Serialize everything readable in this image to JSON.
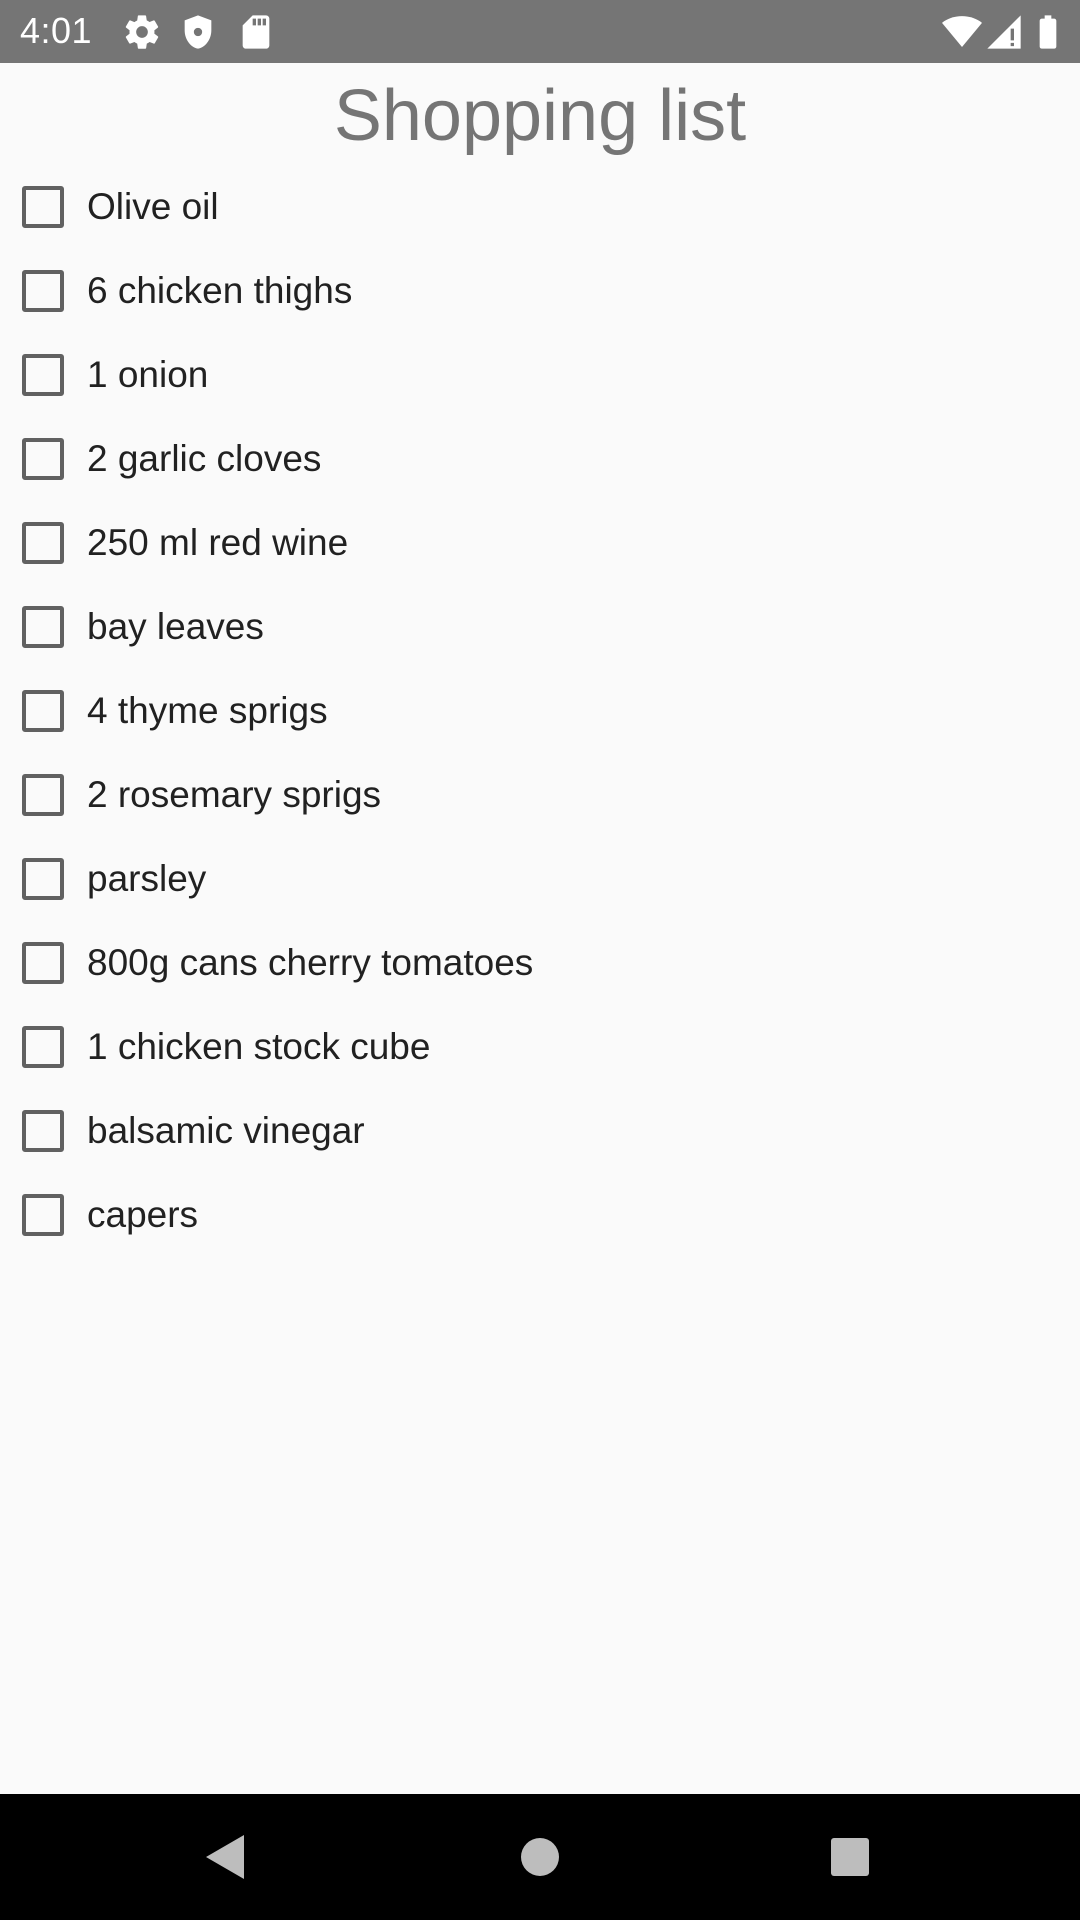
{
  "status_bar": {
    "time": "4:01",
    "icons_left": [
      "gear-icon",
      "shield-icon",
      "sd-card-icon"
    ],
    "icons_right": [
      "wifi-icon",
      "signal-icon",
      "battery-icon"
    ]
  },
  "page": {
    "title": "Shopping list"
  },
  "items": [
    {
      "label": "Olive oil",
      "checked": false
    },
    {
      "label": "6 chicken thighs",
      "checked": false
    },
    {
      "label": "1 onion",
      "checked": false
    },
    {
      "label": "2 garlic cloves",
      "checked": false
    },
    {
      "label": "250 ml red wine",
      "checked": false
    },
    {
      "label": "bay leaves",
      "checked": false
    },
    {
      "label": "4 thyme sprigs",
      "checked": false
    },
    {
      "label": "2 rosemary sprigs",
      "checked": false
    },
    {
      "label": "parsley",
      "checked": false
    },
    {
      "label": "800g cans cherry tomatoes",
      "checked": false
    },
    {
      "label": "1 chicken stock cube",
      "checked": false
    },
    {
      "label": "balsamic vinegar",
      "checked": false
    },
    {
      "label": "capers",
      "checked": false
    }
  ],
  "nav_bar": {
    "buttons": [
      "back-icon",
      "home-icon",
      "recents-icon"
    ]
  },
  "colors": {
    "status_bar": "#757575",
    "background": "#fafafa",
    "title": "#757575",
    "text": "#212121",
    "checkbox_border": "#616161",
    "nav_bar": "#000000"
  }
}
